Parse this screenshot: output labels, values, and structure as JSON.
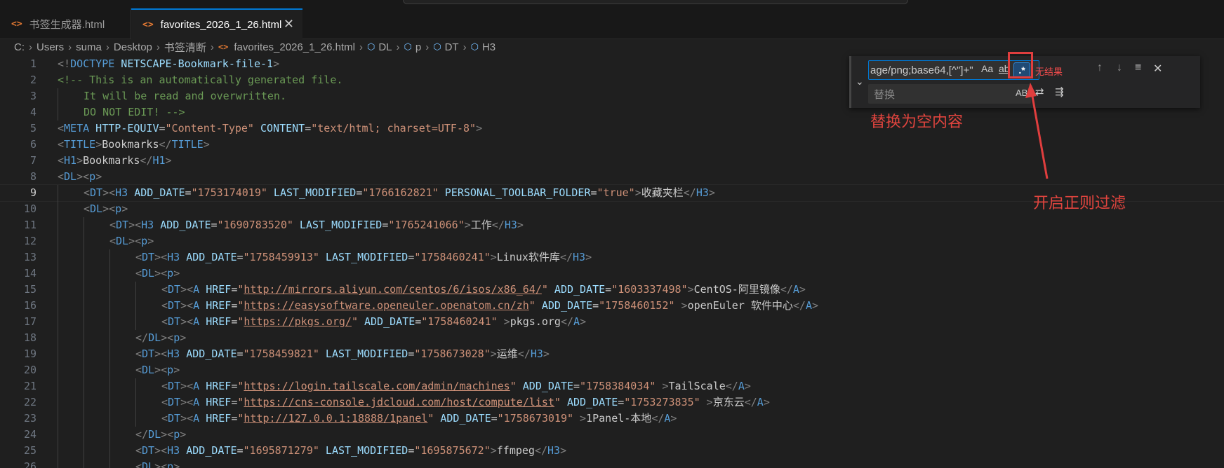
{
  "tabs": [
    {
      "label": "书签生成器.html",
      "icon": "<>"
    },
    {
      "label": "favorites_2026_1_26.html",
      "icon": "<>",
      "active": true,
      "close": "✕"
    }
  ],
  "breadcrumb": {
    "parts": [
      "C:",
      "Users",
      "suma",
      "Desktop",
      "书签清断"
    ],
    "file": "favorites_2026_1_26.html",
    "symbols": [
      "DL",
      "p",
      "DT",
      "H3"
    ],
    "separator": "›"
  },
  "editor": {
    "current_line": 9,
    "lines": [
      {
        "n": "1",
        "ind": 0,
        "segs": [
          [
            "t",
            "<!"
          ],
          [
            "tn",
            "DOCTYPE"
          ],
          [
            "an",
            " NETSCAPE-Bookmark-file-1"
          ],
          [
            "t",
            ">"
          ]
        ]
      },
      {
        "n": "2",
        "ind": 0,
        "segs": [
          [
            "cm",
            "<!-- This is an automatically generated file."
          ]
        ]
      },
      {
        "n": "3",
        "ind": 1,
        "segs": [
          [
            "cm",
            "It will be read and overwritten."
          ]
        ]
      },
      {
        "n": "4",
        "ind": 1,
        "segs": [
          [
            "cm",
            "DO NOT EDIT! -->"
          ]
        ]
      },
      {
        "n": "5",
        "ind": 0,
        "segs": [
          [
            "t",
            "<"
          ],
          [
            "tn",
            "META"
          ],
          [
            "an",
            " HTTP-EQUIV"
          ],
          [
            "tx",
            "="
          ],
          [
            "av",
            "\"Content-Type\""
          ],
          [
            "an",
            " CONTENT"
          ],
          [
            "tx",
            "="
          ],
          [
            "av",
            "\"text/html; charset=UTF-8\""
          ],
          [
            "t",
            ">"
          ]
        ]
      },
      {
        "n": "6",
        "ind": 0,
        "segs": [
          [
            "t",
            "<"
          ],
          [
            "tn",
            "TITLE"
          ],
          [
            "t",
            ">"
          ],
          [
            "tx",
            "Bookmarks"
          ],
          [
            "t",
            "</"
          ],
          [
            "tn",
            "TITLE"
          ],
          [
            "t",
            ">"
          ]
        ]
      },
      {
        "n": "7",
        "ind": 0,
        "segs": [
          [
            "t",
            "<"
          ],
          [
            "tn",
            "H1"
          ],
          [
            "t",
            ">"
          ],
          [
            "tx",
            "Bookmarks"
          ],
          [
            "t",
            "</"
          ],
          [
            "tn",
            "H1"
          ],
          [
            "t",
            ">"
          ]
        ]
      },
      {
        "n": "8",
        "ind": 0,
        "segs": [
          [
            "t",
            "<"
          ],
          [
            "tn",
            "DL"
          ],
          [
            "t",
            "><"
          ],
          [
            "tn",
            "p"
          ],
          [
            "t",
            ">"
          ]
        ]
      },
      {
        "n": "9",
        "ind": 1,
        "segs": [
          [
            "t",
            "<"
          ],
          [
            "tn",
            "DT"
          ],
          [
            "t",
            "><"
          ],
          [
            "tn",
            "H3"
          ],
          [
            "an",
            " ADD_DATE"
          ],
          [
            "tx",
            "="
          ],
          [
            "av",
            "\"1753174019\""
          ],
          [
            "an",
            " LAST_MODIFIED"
          ],
          [
            "tx",
            "="
          ],
          [
            "av",
            "\"1766162821\""
          ],
          [
            "an",
            " PERSONAL_TOOLBAR_FOLDER"
          ],
          [
            "tx",
            "="
          ],
          [
            "av",
            "\"true\""
          ],
          [
            "t",
            ">"
          ],
          [
            "tx",
            "收藏夹栏"
          ],
          [
            "t",
            "</"
          ],
          [
            "tn",
            "H3"
          ],
          [
            "t",
            ">"
          ]
        ]
      },
      {
        "n": "10",
        "ind": 1,
        "segs": [
          [
            "t",
            "<"
          ],
          [
            "tn",
            "DL"
          ],
          [
            "t",
            "><"
          ],
          [
            "tn",
            "p"
          ],
          [
            "t",
            ">"
          ]
        ]
      },
      {
        "n": "11",
        "ind": 2,
        "segs": [
          [
            "t",
            "<"
          ],
          [
            "tn",
            "DT"
          ],
          [
            "t",
            "><"
          ],
          [
            "tn",
            "H3"
          ],
          [
            "an",
            " ADD_DATE"
          ],
          [
            "tx",
            "="
          ],
          [
            "av",
            "\"1690783520\""
          ],
          [
            "an",
            " LAST_MODIFIED"
          ],
          [
            "tx",
            "="
          ],
          [
            "av",
            "\"1765241066\""
          ],
          [
            "t",
            ">"
          ],
          [
            "tx",
            "工作"
          ],
          [
            "t",
            "</"
          ],
          [
            "tn",
            "H3"
          ],
          [
            "t",
            ">"
          ]
        ]
      },
      {
        "n": "12",
        "ind": 2,
        "segs": [
          [
            "t",
            "<"
          ],
          [
            "tn",
            "DL"
          ],
          [
            "t",
            "><"
          ],
          [
            "tn",
            "p"
          ],
          [
            "t",
            ">"
          ]
        ]
      },
      {
        "n": "13",
        "ind": 3,
        "segs": [
          [
            "t",
            "<"
          ],
          [
            "tn",
            "DT"
          ],
          [
            "t",
            "><"
          ],
          [
            "tn",
            "H3"
          ],
          [
            "an",
            " ADD_DATE"
          ],
          [
            "tx",
            "="
          ],
          [
            "av",
            "\"1758459913\""
          ],
          [
            "an",
            " LAST_MODIFIED"
          ],
          [
            "tx",
            "="
          ],
          [
            "av",
            "\"1758460241\""
          ],
          [
            "t",
            ">"
          ],
          [
            "tx",
            "Linux软件库"
          ],
          [
            "t",
            "</"
          ],
          [
            "tn",
            "H3"
          ],
          [
            "t",
            ">"
          ]
        ]
      },
      {
        "n": "14",
        "ind": 3,
        "segs": [
          [
            "t",
            "<"
          ],
          [
            "tn",
            "DL"
          ],
          [
            "t",
            "><"
          ],
          [
            "tn",
            "p"
          ],
          [
            "t",
            ">"
          ]
        ]
      },
      {
        "n": "15",
        "ind": 4,
        "segs": [
          [
            "t",
            "<"
          ],
          [
            "tn",
            "DT"
          ],
          [
            "t",
            "><"
          ],
          [
            "tn",
            "A"
          ],
          [
            "an",
            " HREF"
          ],
          [
            "tx",
            "="
          ],
          [
            "av",
            "\""
          ],
          [
            "avu",
            "http://mirrors.aliyun.com/centos/6/isos/x86_64/"
          ],
          [
            "av",
            "\""
          ],
          [
            "an",
            " ADD_DATE"
          ],
          [
            "tx",
            "="
          ],
          [
            "av",
            "\"1603337498\""
          ],
          [
            "t",
            ">"
          ],
          [
            "tx",
            "CentOS-阿里镜像"
          ],
          [
            "t",
            "</"
          ],
          [
            "tn",
            "A"
          ],
          [
            "t",
            ">"
          ]
        ]
      },
      {
        "n": "16",
        "ind": 4,
        "segs": [
          [
            "t",
            "<"
          ],
          [
            "tn",
            "DT"
          ],
          [
            "t",
            "><"
          ],
          [
            "tn",
            "A"
          ],
          [
            "an",
            " HREF"
          ],
          [
            "tx",
            "="
          ],
          [
            "av",
            "\""
          ],
          [
            "avu",
            "https://easysoftware.openeuler.openatom.cn/zh"
          ],
          [
            "av",
            "\""
          ],
          [
            "an",
            " ADD_DATE"
          ],
          [
            "tx",
            "="
          ],
          [
            "av",
            "\"1758460152\""
          ],
          [
            "t",
            " >"
          ],
          [
            "tx",
            "openEuler 软件中心"
          ],
          [
            "t",
            "</"
          ],
          [
            "tn",
            "A"
          ],
          [
            "t",
            ">"
          ]
        ]
      },
      {
        "n": "17",
        "ind": 4,
        "segs": [
          [
            "t",
            "<"
          ],
          [
            "tn",
            "DT"
          ],
          [
            "t",
            "><"
          ],
          [
            "tn",
            "A"
          ],
          [
            "an",
            " HREF"
          ],
          [
            "tx",
            "="
          ],
          [
            "av",
            "\""
          ],
          [
            "avu",
            "https://pkgs.org/"
          ],
          [
            "av",
            "\""
          ],
          [
            "an",
            " ADD_DATE"
          ],
          [
            "tx",
            "="
          ],
          [
            "av",
            "\"1758460241\""
          ],
          [
            "t",
            " >"
          ],
          [
            "tx",
            "pkgs.org"
          ],
          [
            "t",
            "</"
          ],
          [
            "tn",
            "A"
          ],
          [
            "t",
            ">"
          ]
        ]
      },
      {
        "n": "18",
        "ind": 3,
        "segs": [
          [
            "t",
            "</"
          ],
          [
            "tn",
            "DL"
          ],
          [
            "t",
            "><"
          ],
          [
            "tn",
            "p"
          ],
          [
            "t",
            ">"
          ]
        ]
      },
      {
        "n": "19",
        "ind": 3,
        "segs": [
          [
            "t",
            "<"
          ],
          [
            "tn",
            "DT"
          ],
          [
            "t",
            "><"
          ],
          [
            "tn",
            "H3"
          ],
          [
            "an",
            " ADD_DATE"
          ],
          [
            "tx",
            "="
          ],
          [
            "av",
            "\"1758459821\""
          ],
          [
            "an",
            " LAST_MODIFIED"
          ],
          [
            "tx",
            "="
          ],
          [
            "av",
            "\"1758673028\""
          ],
          [
            "t",
            ">"
          ],
          [
            "tx",
            "运维"
          ],
          [
            "t",
            "</"
          ],
          [
            "tn",
            "H3"
          ],
          [
            "t",
            ">"
          ]
        ]
      },
      {
        "n": "20",
        "ind": 3,
        "segs": [
          [
            "t",
            "<"
          ],
          [
            "tn",
            "DL"
          ],
          [
            "t",
            "><"
          ],
          [
            "tn",
            "p"
          ],
          [
            "t",
            ">"
          ]
        ]
      },
      {
        "n": "21",
        "ind": 4,
        "segs": [
          [
            "t",
            "<"
          ],
          [
            "tn",
            "DT"
          ],
          [
            "t",
            "><"
          ],
          [
            "tn",
            "A"
          ],
          [
            "an",
            " HREF"
          ],
          [
            "tx",
            "="
          ],
          [
            "av",
            "\""
          ],
          [
            "avu",
            "https://login.tailscale.com/admin/machines"
          ],
          [
            "av",
            "\""
          ],
          [
            "an",
            " ADD_DATE"
          ],
          [
            "tx",
            "="
          ],
          [
            "av",
            "\"1758384034\""
          ],
          [
            "t",
            " >"
          ],
          [
            "tx",
            "TailScale"
          ],
          [
            "t",
            "</"
          ],
          [
            "tn",
            "A"
          ],
          [
            "t",
            ">"
          ]
        ]
      },
      {
        "n": "22",
        "ind": 4,
        "segs": [
          [
            "t",
            "<"
          ],
          [
            "tn",
            "DT"
          ],
          [
            "t",
            "><"
          ],
          [
            "tn",
            "A"
          ],
          [
            "an",
            " HREF"
          ],
          [
            "tx",
            "="
          ],
          [
            "av",
            "\""
          ],
          [
            "avu",
            "https://cns-console.jdcloud.com/host/compute/list"
          ],
          [
            "av",
            "\""
          ],
          [
            "an",
            " ADD_DATE"
          ],
          [
            "tx",
            "="
          ],
          [
            "av",
            "\"1753273835\""
          ],
          [
            "t",
            " >"
          ],
          [
            "tx",
            "京东云"
          ],
          [
            "t",
            "</"
          ],
          [
            "tn",
            "A"
          ],
          [
            "t",
            ">"
          ]
        ]
      },
      {
        "n": "23",
        "ind": 4,
        "segs": [
          [
            "t",
            "<"
          ],
          [
            "tn",
            "DT"
          ],
          [
            "t",
            "><"
          ],
          [
            "tn",
            "A"
          ],
          [
            "an",
            " HREF"
          ],
          [
            "tx",
            "="
          ],
          [
            "av",
            "\""
          ],
          [
            "avu",
            "http://127.0.0.1:18888/1panel"
          ],
          [
            "av",
            "\""
          ],
          [
            "an",
            " ADD_DATE"
          ],
          [
            "tx",
            "="
          ],
          [
            "av",
            "\"1758673019\""
          ],
          [
            "t",
            " >"
          ],
          [
            "tx",
            "1Panel-本地"
          ],
          [
            "t",
            "</"
          ],
          [
            "tn",
            "A"
          ],
          [
            "t",
            ">"
          ]
        ]
      },
      {
        "n": "24",
        "ind": 3,
        "segs": [
          [
            "t",
            "</"
          ],
          [
            "tn",
            "DL"
          ],
          [
            "t",
            "><"
          ],
          [
            "tn",
            "p"
          ],
          [
            "t",
            ">"
          ]
        ]
      },
      {
        "n": "25",
        "ind": 3,
        "segs": [
          [
            "t",
            "<"
          ],
          [
            "tn",
            "DT"
          ],
          [
            "t",
            "><"
          ],
          [
            "tn",
            "H3"
          ],
          [
            "an",
            " ADD_DATE"
          ],
          [
            "tx",
            "="
          ],
          [
            "av",
            "\"1695871279\""
          ],
          [
            "an",
            " LAST_MODIFIED"
          ],
          [
            "tx",
            "="
          ],
          [
            "av",
            "\"1695875672\""
          ],
          [
            "t",
            ">"
          ],
          [
            "tx",
            "ffmpeg"
          ],
          [
            "t",
            "</"
          ],
          [
            "tn",
            "H3"
          ],
          [
            "t",
            ">"
          ]
        ]
      },
      {
        "n": "26",
        "ind": 3,
        "segs": [
          [
            "t",
            "<"
          ],
          [
            "tn",
            "DL"
          ],
          [
            "t",
            "><"
          ],
          [
            "tn",
            "p"
          ],
          [
            "t",
            ">"
          ]
        ]
      }
    ]
  },
  "find_widget": {
    "expand_icon": "chevron-down-icon",
    "search_value": "age/png;base64,[^\"]+\"",
    "match_case": "Aa",
    "whole_word": "ab",
    "regex": ".*",
    "no_results": "无结果",
    "replace_placeholder": "替换",
    "preserve_case": "AB",
    "prev_icon": "↑",
    "next_icon": "↓",
    "selection_icon": "≡",
    "close_icon": "✕"
  },
  "annotations": {
    "replace_note": "替换为空内容",
    "regex_note": "开启正则过滤",
    "color": "#e0443e"
  },
  "colors": {
    "accent": "#0078d4",
    "annotation": "#e03e3e"
  }
}
